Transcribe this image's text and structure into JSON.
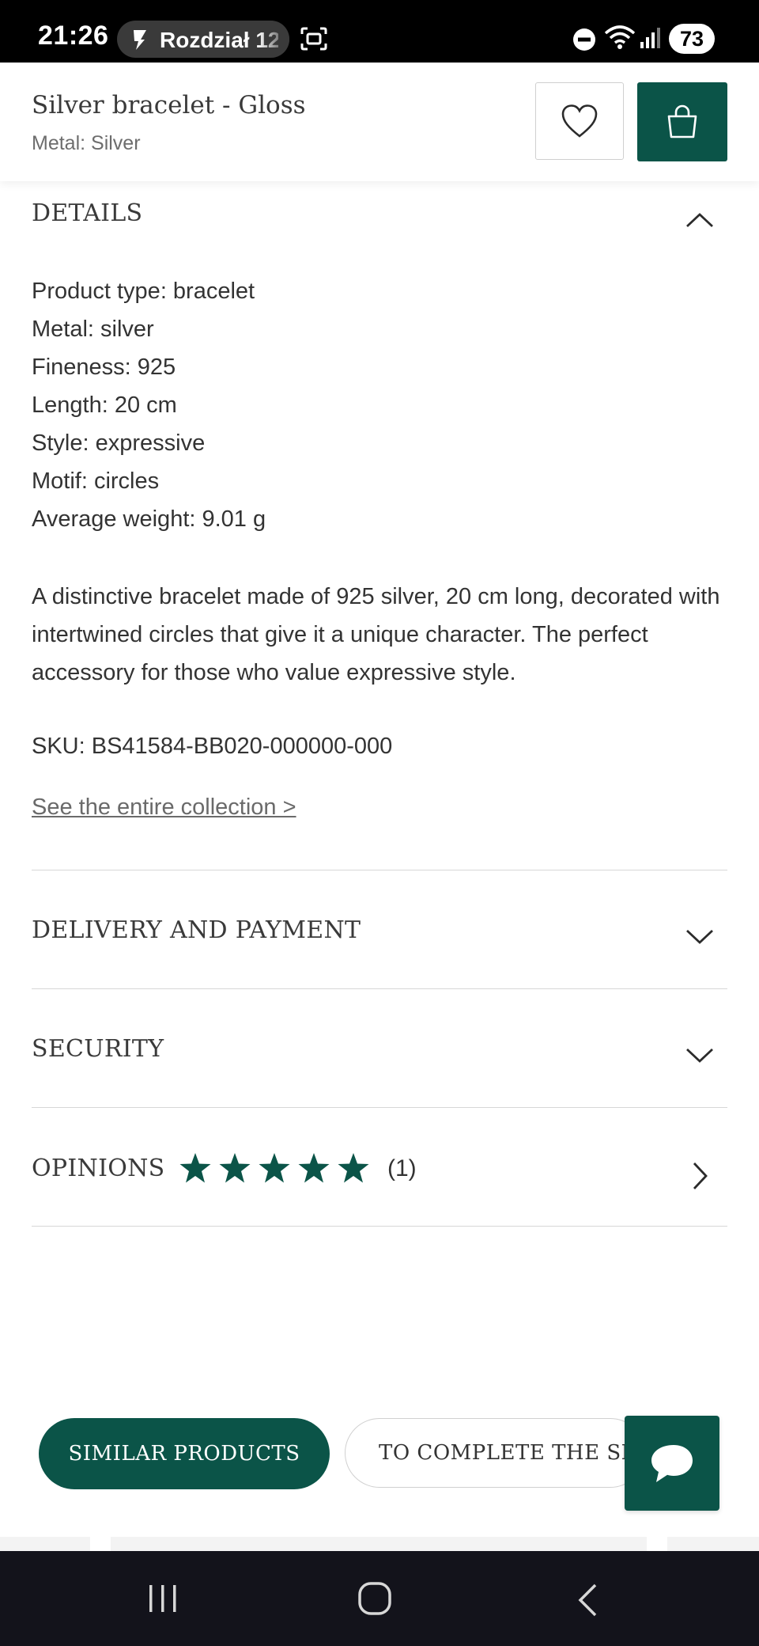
{
  "status_bar": {
    "time": "21:26",
    "notification_text": "Rozdział 12",
    "battery": "73"
  },
  "header": {
    "title": "Silver bracelet - Gloss",
    "subtitle": "Metal: Silver",
    "wishlist_icon": "heart-icon",
    "cart_icon": "shopping-bag-icon"
  },
  "details": {
    "title": "DETAILS",
    "specs": [
      "Product type: bracelet",
      "Metal: silver",
      "Fineness: 925",
      "Length: 20 cm",
      "Style: expressive",
      "Motif: circles",
      "Average weight: 9.01 g"
    ],
    "description": "A distinctive bracelet made of 925 silver, 20 cm long, decorated with intertwined circles that give it a unique character. The perfect accessory for those who value expressive style.",
    "sku": "SKU: BS41584-BB020-000000-000",
    "collection_link": "See the entire collection >"
  },
  "sections": {
    "delivery": "DELIVERY AND PAYMENT",
    "security": "SECURITY",
    "opinions": "OPINIONS",
    "opinions_count": "(1)",
    "rating": 5,
    "rating_max": 5
  },
  "tabs": {
    "similar": "SIMILAR PRODUCTS",
    "complete_set": "TO COMPLETE THE SET"
  },
  "colors": {
    "brand": "#0b5448"
  }
}
